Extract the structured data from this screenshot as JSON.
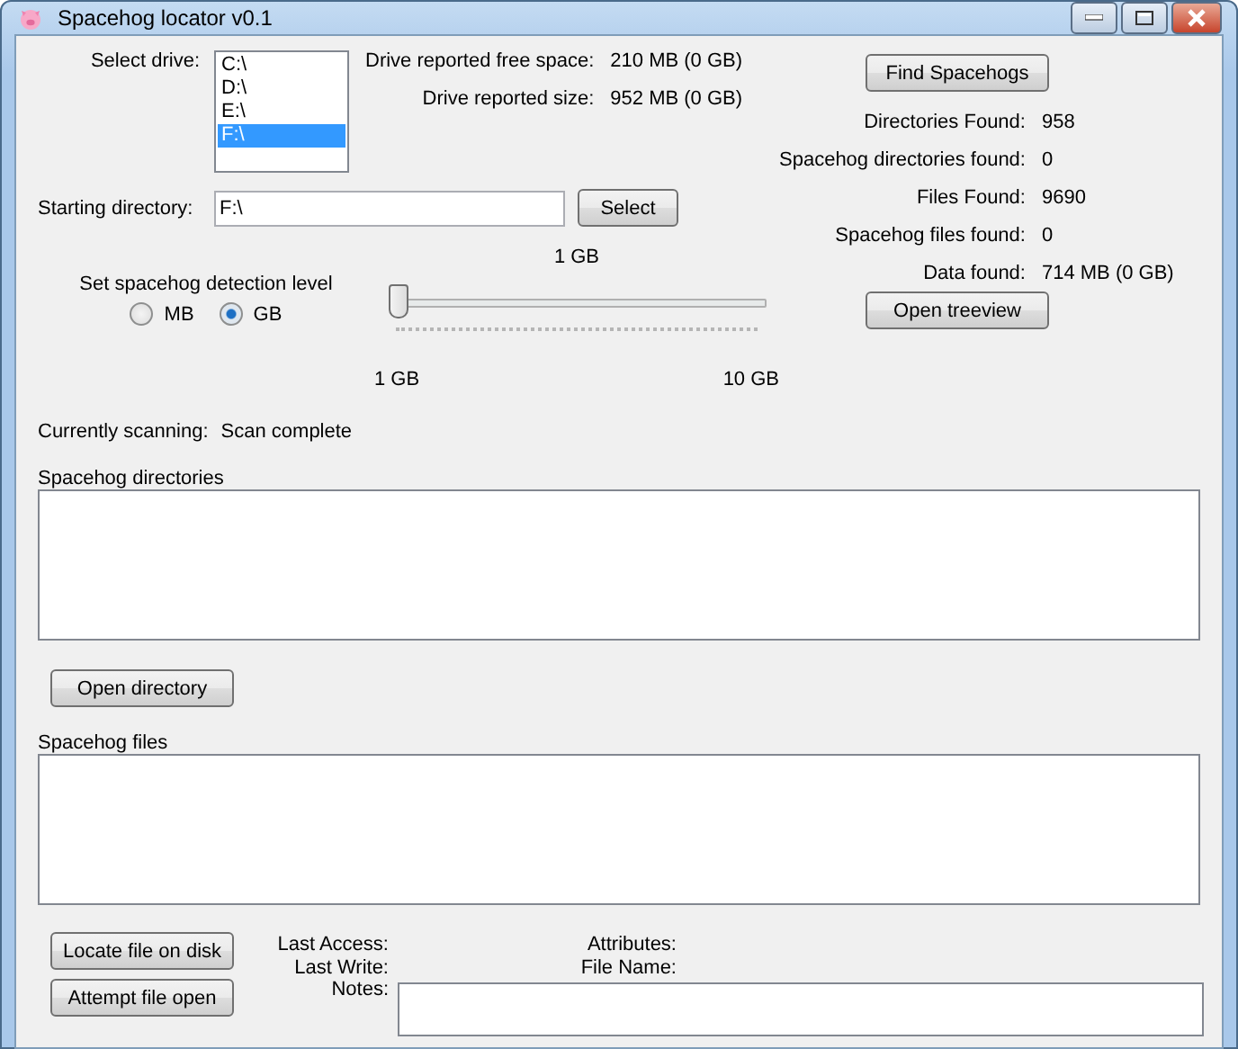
{
  "window": {
    "title": "Spacehog locator v0.1"
  },
  "drive": {
    "label": "Select drive:",
    "items": [
      {
        "label": "C:\\",
        "selected": false
      },
      {
        "label": "D:\\",
        "selected": false
      },
      {
        "label": "E:\\",
        "selected": false
      },
      {
        "label": "F:\\",
        "selected": true
      }
    ]
  },
  "drive_info": [
    {
      "label": "Drive reported free space:",
      "value": "210 MB (0 GB)"
    },
    {
      "label": "Drive reported size:",
      "value": "952 MB (0 GB)"
    }
  ],
  "starting_directory": {
    "label": "Starting directory:",
    "value": "F:\\",
    "button": "Select"
  },
  "detection": {
    "label": "Set spacehog detection level",
    "units": [
      {
        "label": "MB",
        "selected": false
      },
      {
        "label": "GB",
        "selected": true
      }
    ],
    "reading": "1 GB",
    "level": 0,
    "min_label": "1 GB",
    "max_label": "10 GB"
  },
  "scanning": {
    "label": "Currently scanning:",
    "value": "Scan complete"
  },
  "find_button": "Find Spacehogs",
  "stats": [
    {
      "label": "Directories Found:",
      "value": "958"
    },
    {
      "label": "Spacehog directories found:",
      "value": "0"
    },
    {
      "label": "Files Found:",
      "value": "9690"
    },
    {
      "label": "Spacehog files found:",
      "value": "0"
    },
    {
      "label": "Data found:",
      "value": "714 MB (0 GB)"
    }
  ],
  "treeview_button": "Open treeview",
  "directories": {
    "label": "Spacehog directories",
    "button": "Open directory"
  },
  "files": {
    "label": "Spacehog files"
  },
  "file_buttons": [
    "Locate file on disk",
    "Attempt file open"
  ],
  "file_details": [
    {
      "label": "Last Access:"
    },
    {
      "label": "Last Write:"
    }
  ],
  "file_details_right": [
    {
      "label": "Attributes:"
    },
    {
      "label": "File Name:"
    }
  ],
  "notes": {
    "label": "Notes:"
  }
}
